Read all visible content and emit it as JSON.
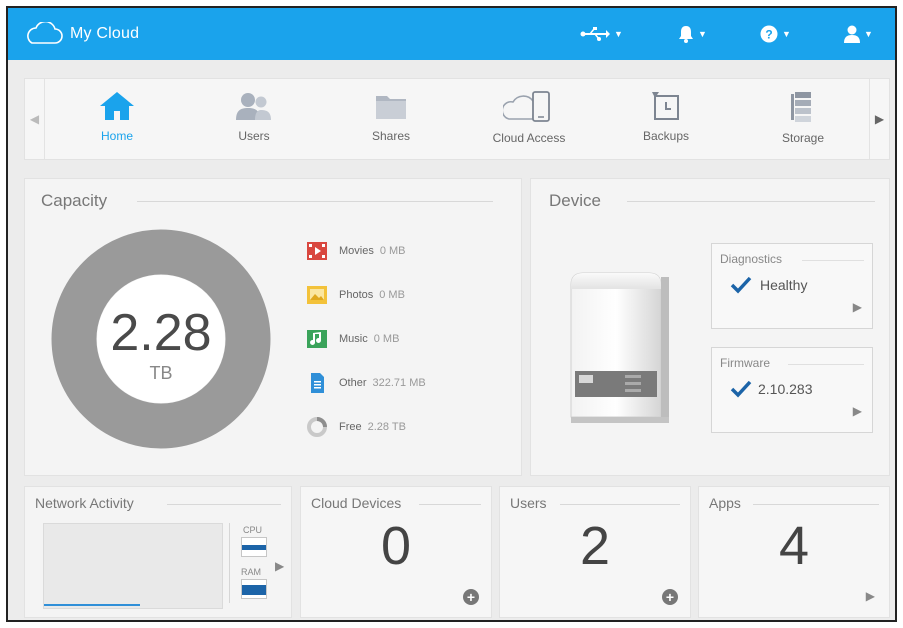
{
  "header": {
    "app_title": "My Cloud",
    "icons": [
      "usb-icon",
      "bell-icon",
      "help-icon",
      "user-icon"
    ],
    "accent_color": "#1aa3ec"
  },
  "nav": {
    "items": [
      {
        "label": "Home",
        "icon": "home-icon",
        "active": true
      },
      {
        "label": "Users",
        "icon": "users-icon"
      },
      {
        "label": "Shares",
        "icon": "folder-icon"
      },
      {
        "label": "Cloud Access",
        "icon": "cloud-device-icon"
      },
      {
        "label": "Backups",
        "icon": "backup-icon"
      },
      {
        "label": "Storage",
        "icon": "storage-icon"
      }
    ]
  },
  "capacity": {
    "title": "Capacity",
    "total_value": "2.28",
    "total_unit": "TB",
    "legend": [
      {
        "label": "Movies",
        "value": "0 MB",
        "color": "#d9473f"
      },
      {
        "label": "Photos",
        "value": "0 MB",
        "color": "#f3c23a"
      },
      {
        "label": "Music",
        "value": "0 MB",
        "color": "#3aa35a"
      },
      {
        "label": "Other",
        "value": "322.71 MB",
        "color": "#2f8fd8"
      },
      {
        "label": "Free",
        "value": "2.28 TB",
        "color": "#c9c9c9"
      }
    ]
  },
  "device": {
    "title": "Device",
    "diagnostics": {
      "title": "Diagnostics",
      "value": "Healthy"
    },
    "firmware": {
      "title": "Firmware",
      "value": "2.10.283"
    }
  },
  "network": {
    "title": "Network Activity",
    "cpu_label": "CPU",
    "ram_label": "RAM"
  },
  "stats": {
    "cloud_devices": {
      "title": "Cloud Devices",
      "value": "0"
    },
    "users": {
      "title": "Users",
      "value": "2"
    },
    "apps": {
      "title": "Apps",
      "value": "4"
    }
  }
}
